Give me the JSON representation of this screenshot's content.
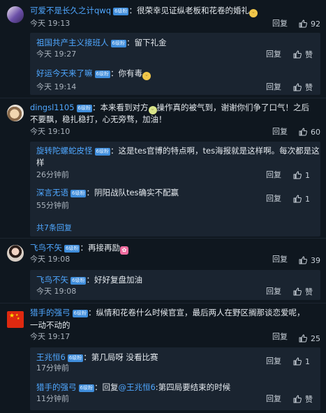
{
  "badge": "6级粉",
  "reply_label": "回复",
  "comments": [
    {
      "user": "可爱不是长久之计qwq",
      "text": "很荣幸见证纵老板和花卷的婚礼",
      "emoji": "cat-emoji",
      "time": "今天 19:13",
      "likes": "92",
      "replies": [
        {
          "user": "祖国共产主义接班人",
          "text": "留下礼金",
          "time": "今天 19:27",
          "likes": "赞"
        },
        {
          "user": "好运今天来了嘛",
          "text": "你有毒",
          "emoji": "cat-emoji",
          "time": "今天 19:14",
          "likes": "赞"
        }
      ]
    },
    {
      "user": "dingsl1105",
      "text_before_emoji": "本来看到对方",
      "text_after_emoji": "操作真的被气到，谢谢你们争了口气！之后",
      "text_line2": "不要飘，稳扎稳打，心无旁骛，加油！",
      "emoji": "grin-emoji",
      "time": "今天 19:10",
      "likes": "60",
      "replies": [
        {
          "user": "旋转陀螺蛇皮怪",
          "text": "这是tes官博的特点啊，tes海报就是这样啊。每次都是这",
          "text_line2": "样",
          "time": "26分钟前",
          "likes": "1"
        },
        {
          "user": "深言无语",
          "text": "阴阳战队tes确实不配赢",
          "time": "55分钟前",
          "likes": "1"
        }
      ],
      "more_replies": "共7条回复"
    },
    {
      "user": "飞鸟不矢",
      "text": "再接再励",
      "emoji": "bow-emoji",
      "time": "今天 19:08",
      "likes": "39",
      "replies": [
        {
          "user": "飞鸟不矢",
          "text": "好好复盘加油",
          "time": "今天 19:08",
          "likes": "赞"
        }
      ]
    },
    {
      "user": "猎手的强弓",
      "text": "纵情和花卷什么时候官宣，最后两人在野区搁那谈恋爱呢，",
      "text_line2": "一动不动的",
      "time": "今天 19:17",
      "likes": "25",
      "replies": [
        {
          "user": "王兆恒6",
          "text": "第几局呀 没看比赛",
          "time": "17分钟前",
          "likes": "1"
        },
        {
          "user": "猎手的强弓",
          "reply_prefix": "回复",
          "at_user": "@王兆恒6",
          "text": ":第四局要结束的时候",
          "time": "11分钟前",
          "likes": "赞"
        }
      ]
    }
  ]
}
